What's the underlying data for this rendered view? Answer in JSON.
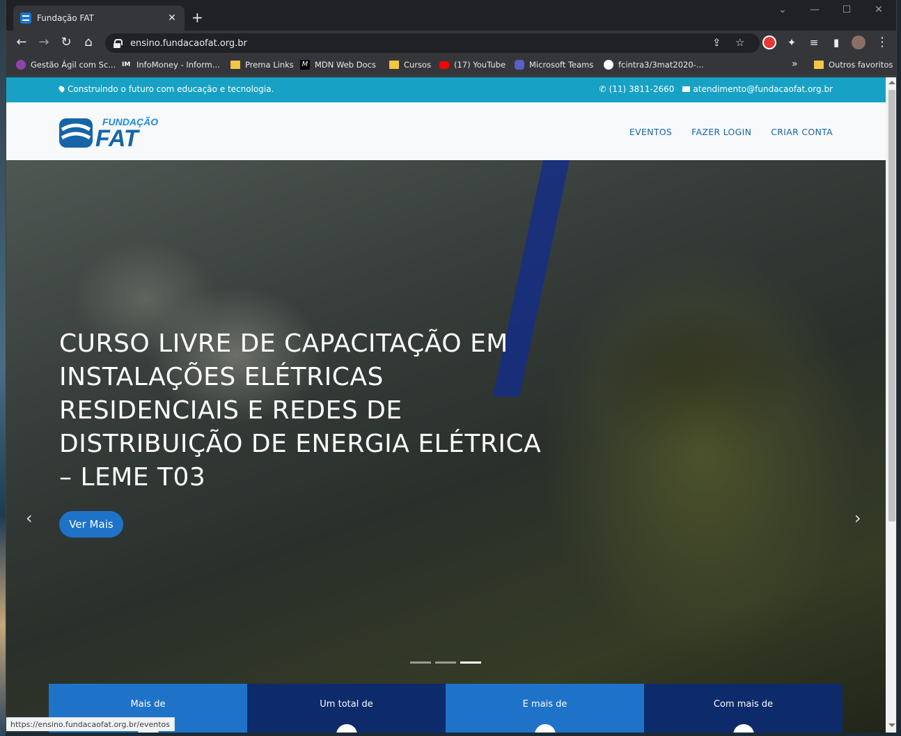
{
  "browser": {
    "tab_title": "Fundação FAT",
    "url": "ensino.fundacaofat.org.br",
    "status_url": "https://ensino.fundacaofat.org.br/eventos"
  },
  "bookmarks": [
    {
      "label": "Gestão Ágil com Sc...",
      "icon": "agile-icon",
      "color": "#8e44ad"
    },
    {
      "label": "InfoMoney - Inform...",
      "icon": "infomoney-icon",
      "color": "#35363a"
    },
    {
      "label": "Prema Links",
      "icon": "folder-icon",
      "color": "#f4c542"
    },
    {
      "label": "MDN Web Docs",
      "icon": "mdn-icon",
      "color": "#000000"
    },
    {
      "label": "Cursos",
      "icon": "folder-icon",
      "color": "#f4c542"
    },
    {
      "label": "(17) YouTube",
      "icon": "youtube-icon",
      "color": "#ff0000"
    },
    {
      "label": "Microsoft Teams",
      "icon": "teams-icon",
      "color": "#5b5fc7"
    },
    {
      "label": "fcintra3/3mat2020-...",
      "icon": "github-icon",
      "color": "#ffffff"
    }
  ],
  "bookmarks_more": "»",
  "other_bookmarks": "Outros favoritos",
  "topbar": {
    "tagline": "Construindo o futuro com educação e tecnologia.",
    "phone": "(11) 3811-2660",
    "email": "atendimento@fundacaofat.org.br"
  },
  "logo": {
    "top": "FUNDAÇÃO",
    "bottom": "FAT"
  },
  "nav": [
    "EVENTOS",
    "FAZER LOGIN",
    "CRIAR CONTA"
  ],
  "hero": {
    "title": "CURSO LIVRE DE CAPACITAÇÃO EM INSTALAÇÕES ELÉTRICAS RESIDENCIAIS E REDES DE DISTRIBUIÇÃO DE ENERGIA ELÉTRICA – LEME T03",
    "button": "Ver Mais",
    "active_slide": 3,
    "slide_count": 3
  },
  "stats": [
    {
      "label": "Mais de",
      "color": "#1e73c8"
    },
    {
      "label": "Um total de",
      "color": "#0d2a6b"
    },
    {
      "label": "E mais de",
      "color": "#1e73c8"
    },
    {
      "label": "Com mais de",
      "color": "#0d2a6b"
    }
  ],
  "colors": {
    "topbar": "#17a2c5",
    "brand": "#1565a8",
    "button": "#1e73c8"
  }
}
